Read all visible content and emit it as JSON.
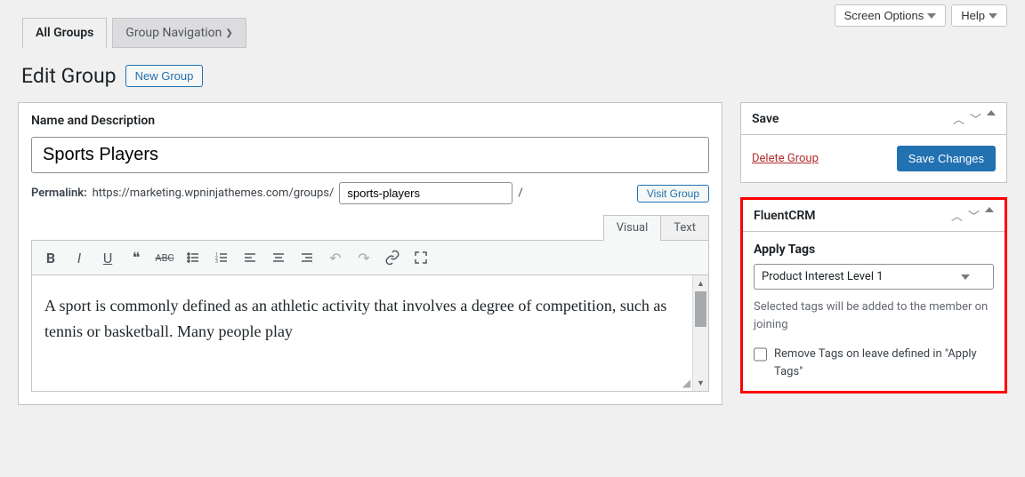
{
  "top": {
    "screen_options": "Screen Options",
    "help": "Help"
  },
  "tabs": {
    "all_groups": "All Groups",
    "group_navigation": "Group Navigation"
  },
  "page": {
    "title": "Edit Group",
    "new_group": "New Group"
  },
  "main": {
    "section_label": "Name and Description",
    "title_value": "Sports Players",
    "permalink_label": "Permalink:",
    "permalink_base": "https://marketing.wpninjathemes.com/groups/",
    "slug": "sports-players",
    "slug_suffix": "/",
    "visit_group": "Visit Group",
    "editor_tabs": {
      "visual": "Visual",
      "text": "Text"
    },
    "content": "A sport is commonly defined as an athletic activity that involves a degree of competition, such as tennis or basketball. Many people play"
  },
  "save_box": {
    "title": "Save",
    "delete": "Delete Group",
    "save": "Save Changes"
  },
  "fluentcrm": {
    "title": "FluentCRM",
    "apply_tags_label": "Apply Tags",
    "selected_tag": "Product Interest Level 1",
    "helper": "Selected tags will be added to the member on joining",
    "remove_label": "Remove Tags on leave defined in \"Apply Tags\""
  }
}
